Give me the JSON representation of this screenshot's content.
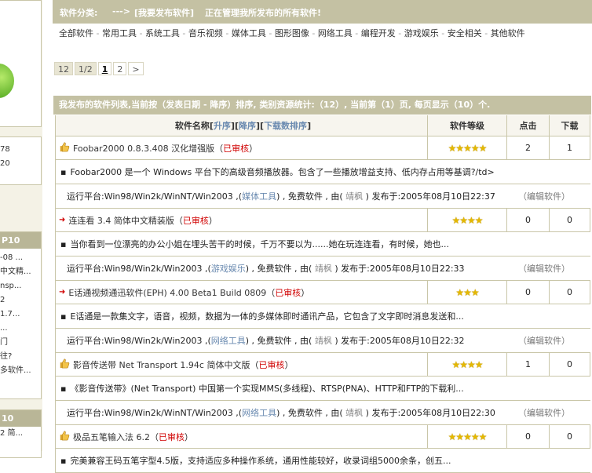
{
  "left": {
    "nums": [
      "78",
      "20"
    ],
    "box1_head": "P10",
    "box1_lines": [
      "-08 ...",
      "中文精...",
      "nsp...",
      "2",
      "1.7...",
      "...",
      "门",
      "往?",
      "多软件..."
    ],
    "box2_head": "10",
    "box2_lines": [
      "2 简..."
    ]
  },
  "category": {
    "label": "软件分类:",
    "arrow": "--->",
    "current": "[我要发布软件]",
    "desc": "正在管理我所发布的所有软件!",
    "links": [
      "全部软件",
      "常用工具",
      "系统工具",
      "音乐视频",
      "媒体工具",
      "图形图像",
      "网络工具",
      "编程开发",
      "游戏娱乐",
      "安全相关",
      "其他软件"
    ]
  },
  "pager": {
    "total": "12",
    "pages": "1/2",
    "current": "1",
    "next": "2",
    "arrow": ">"
  },
  "list": {
    "header": "我发布的软件列表,当前按（发表日期 - 降序）排序, 类别资源统计:（12）, 当前第（1）页, 每页显示（10）个.",
    "col_name_prefix": "软件名称[",
    "col_sort_asc": "升序",
    "col_sort_desc": "降序",
    "col_sort_dl": "下载数排序",
    "col_name_suffix": "]",
    "col_level": "软件等级",
    "col_hits": "点击",
    "col_downloads": "下载",
    "items": [
      {
        "icon": "thumbs-up-icon",
        "name": "Foobar2000 0.8.3.408 汉化增强版",
        "status": "已审核",
        "stars": "★★★★★",
        "hits": "2",
        "downloads": "1",
        "desc": "Foobar2000 是一个 Windows 平台下的高级音频播放器。包含了一些播放增益支持、低内存占用等基调?/td>",
        "platform": "运行平台:Win98/Win2k/WinNT/Win2003",
        "category": "媒体工具",
        "license": "免费软件",
        "by": "由",
        "author": "靖枫",
        "published": "发布于:2005年08月10日22:37",
        "edit": "（编辑软件）"
      },
      {
        "icon": "red-arrow-icon",
        "name": "连连看 3.4 简体中文精装版",
        "status": "已审核",
        "stars": "★★★★",
        "hits": "0",
        "downloads": "0",
        "desc": "当你看到一位漂亮的办公小姐在埋头苦干的时候，千万不要以为......她在玩连连看，有时候，她也...",
        "platform": "运行平台:Win98/Win2k/Win2003",
        "category": "游戏娱乐",
        "license": "免费软件",
        "by": "由",
        "author": "靖枫",
        "published": "发布于:2005年08月10日22:33",
        "edit": "（编辑软件）"
      },
      {
        "icon": "red-arrow-icon",
        "name": "E话通视频通迅软件(EPH) 4.00 Beta1 Build 0809",
        "status": "已审核",
        "stars": "★★★",
        "hits": "0",
        "downloads": "0",
        "desc": "E话通是一款集文字，语音，视频，数据为一体的多媒体即时通讯产品，它包含了文字即时消息发送和...",
        "platform": "运行平台:Win98/Win2k/Win2003",
        "category": "网络工具",
        "license": "免费软件",
        "by": "由",
        "author": "靖枫",
        "published": "发布于:2005年08月10日22:32",
        "edit": "（编辑软件）"
      },
      {
        "icon": "thumbs-up-icon",
        "name": "影音传送带 Net Transport 1.94c 简体中文版",
        "status": "已审核",
        "stars": "★★★★",
        "hits": "1",
        "downloads": "0",
        "desc": "《影音传送带》(Net Transport) 中国第一个实现MMS(多线程)、RTSP(PNA)、HTTP和FTP的下载利...",
        "platform": "运行平台:Win98/Win2k/WinNT/Win2003",
        "category": "网络工具",
        "license": "免费软件",
        "by": "由",
        "author": "靖枫",
        "published": "发布于:2005年08月10日22:30",
        "edit": "（编辑软件）"
      },
      {
        "icon": "thumbs-up-icon",
        "name": "极品五笔输入法 6.2",
        "status": "已审核",
        "stars": "★★★★★",
        "hits": "0",
        "downloads": "0",
        "desc": "完美兼容王码五笔字型4.5版，支持适应多种操作系统，通用性能较好，收录词组5000余条，创五...",
        "platform": "",
        "category": "",
        "license": "",
        "by": "",
        "author": "",
        "published": "",
        "edit": ""
      }
    ]
  }
}
